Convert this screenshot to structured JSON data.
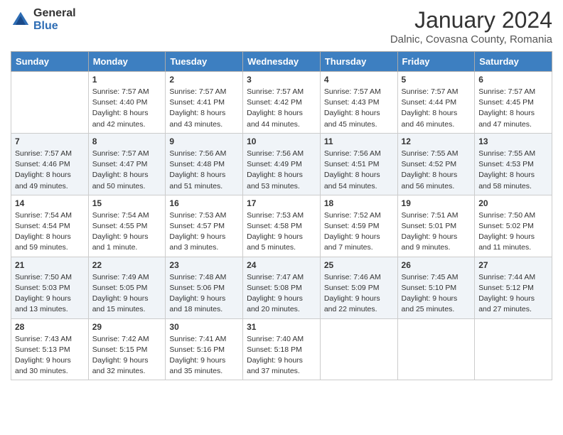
{
  "header": {
    "logo_general": "General",
    "logo_blue": "Blue",
    "month_title": "January 2024",
    "subtitle": "Dalnic, Covasna County, Romania"
  },
  "days_of_week": [
    "Sunday",
    "Monday",
    "Tuesday",
    "Wednesday",
    "Thursday",
    "Friday",
    "Saturday"
  ],
  "rows": [
    {
      "cells": [
        {
          "day": "",
          "info": ""
        },
        {
          "day": "1",
          "info": "Sunrise: 7:57 AM\nSunset: 4:40 PM\nDaylight: 8 hours\nand 42 minutes."
        },
        {
          "day": "2",
          "info": "Sunrise: 7:57 AM\nSunset: 4:41 PM\nDaylight: 8 hours\nand 43 minutes."
        },
        {
          "day": "3",
          "info": "Sunrise: 7:57 AM\nSunset: 4:42 PM\nDaylight: 8 hours\nand 44 minutes."
        },
        {
          "day": "4",
          "info": "Sunrise: 7:57 AM\nSunset: 4:43 PM\nDaylight: 8 hours\nand 45 minutes."
        },
        {
          "day": "5",
          "info": "Sunrise: 7:57 AM\nSunset: 4:44 PM\nDaylight: 8 hours\nand 46 minutes."
        },
        {
          "day": "6",
          "info": "Sunrise: 7:57 AM\nSunset: 4:45 PM\nDaylight: 8 hours\nand 47 minutes."
        }
      ],
      "shaded": false
    },
    {
      "cells": [
        {
          "day": "7",
          "info": "Sunrise: 7:57 AM\nSunset: 4:46 PM\nDaylight: 8 hours\nand 49 minutes."
        },
        {
          "day": "8",
          "info": "Sunrise: 7:57 AM\nSunset: 4:47 PM\nDaylight: 8 hours\nand 50 minutes."
        },
        {
          "day": "9",
          "info": "Sunrise: 7:56 AM\nSunset: 4:48 PM\nDaylight: 8 hours\nand 51 minutes."
        },
        {
          "day": "10",
          "info": "Sunrise: 7:56 AM\nSunset: 4:49 PM\nDaylight: 8 hours\nand 53 minutes."
        },
        {
          "day": "11",
          "info": "Sunrise: 7:56 AM\nSunset: 4:51 PM\nDaylight: 8 hours\nand 54 minutes."
        },
        {
          "day": "12",
          "info": "Sunrise: 7:55 AM\nSunset: 4:52 PM\nDaylight: 8 hours\nand 56 minutes."
        },
        {
          "day": "13",
          "info": "Sunrise: 7:55 AM\nSunset: 4:53 PM\nDaylight: 8 hours\nand 58 minutes."
        }
      ],
      "shaded": true
    },
    {
      "cells": [
        {
          "day": "14",
          "info": "Sunrise: 7:54 AM\nSunset: 4:54 PM\nDaylight: 8 hours\nand 59 minutes."
        },
        {
          "day": "15",
          "info": "Sunrise: 7:54 AM\nSunset: 4:55 PM\nDaylight: 9 hours\nand 1 minute."
        },
        {
          "day": "16",
          "info": "Sunrise: 7:53 AM\nSunset: 4:57 PM\nDaylight: 9 hours\nand 3 minutes."
        },
        {
          "day": "17",
          "info": "Sunrise: 7:53 AM\nSunset: 4:58 PM\nDaylight: 9 hours\nand 5 minutes."
        },
        {
          "day": "18",
          "info": "Sunrise: 7:52 AM\nSunset: 4:59 PM\nDaylight: 9 hours\nand 7 minutes."
        },
        {
          "day": "19",
          "info": "Sunrise: 7:51 AM\nSunset: 5:01 PM\nDaylight: 9 hours\nand 9 minutes."
        },
        {
          "day": "20",
          "info": "Sunrise: 7:50 AM\nSunset: 5:02 PM\nDaylight: 9 hours\nand 11 minutes."
        }
      ],
      "shaded": false
    },
    {
      "cells": [
        {
          "day": "21",
          "info": "Sunrise: 7:50 AM\nSunset: 5:03 PM\nDaylight: 9 hours\nand 13 minutes."
        },
        {
          "day": "22",
          "info": "Sunrise: 7:49 AM\nSunset: 5:05 PM\nDaylight: 9 hours\nand 15 minutes."
        },
        {
          "day": "23",
          "info": "Sunrise: 7:48 AM\nSunset: 5:06 PM\nDaylight: 9 hours\nand 18 minutes."
        },
        {
          "day": "24",
          "info": "Sunrise: 7:47 AM\nSunset: 5:08 PM\nDaylight: 9 hours\nand 20 minutes."
        },
        {
          "day": "25",
          "info": "Sunrise: 7:46 AM\nSunset: 5:09 PM\nDaylight: 9 hours\nand 22 minutes."
        },
        {
          "day": "26",
          "info": "Sunrise: 7:45 AM\nSunset: 5:10 PM\nDaylight: 9 hours\nand 25 minutes."
        },
        {
          "day": "27",
          "info": "Sunrise: 7:44 AM\nSunset: 5:12 PM\nDaylight: 9 hours\nand 27 minutes."
        }
      ],
      "shaded": true
    },
    {
      "cells": [
        {
          "day": "28",
          "info": "Sunrise: 7:43 AM\nSunset: 5:13 PM\nDaylight: 9 hours\nand 30 minutes."
        },
        {
          "day": "29",
          "info": "Sunrise: 7:42 AM\nSunset: 5:15 PM\nDaylight: 9 hours\nand 32 minutes."
        },
        {
          "day": "30",
          "info": "Sunrise: 7:41 AM\nSunset: 5:16 PM\nDaylight: 9 hours\nand 35 minutes."
        },
        {
          "day": "31",
          "info": "Sunrise: 7:40 AM\nSunset: 5:18 PM\nDaylight: 9 hours\nand 37 minutes."
        },
        {
          "day": "",
          "info": ""
        },
        {
          "day": "",
          "info": ""
        },
        {
          "day": "",
          "info": ""
        }
      ],
      "shaded": false
    }
  ]
}
